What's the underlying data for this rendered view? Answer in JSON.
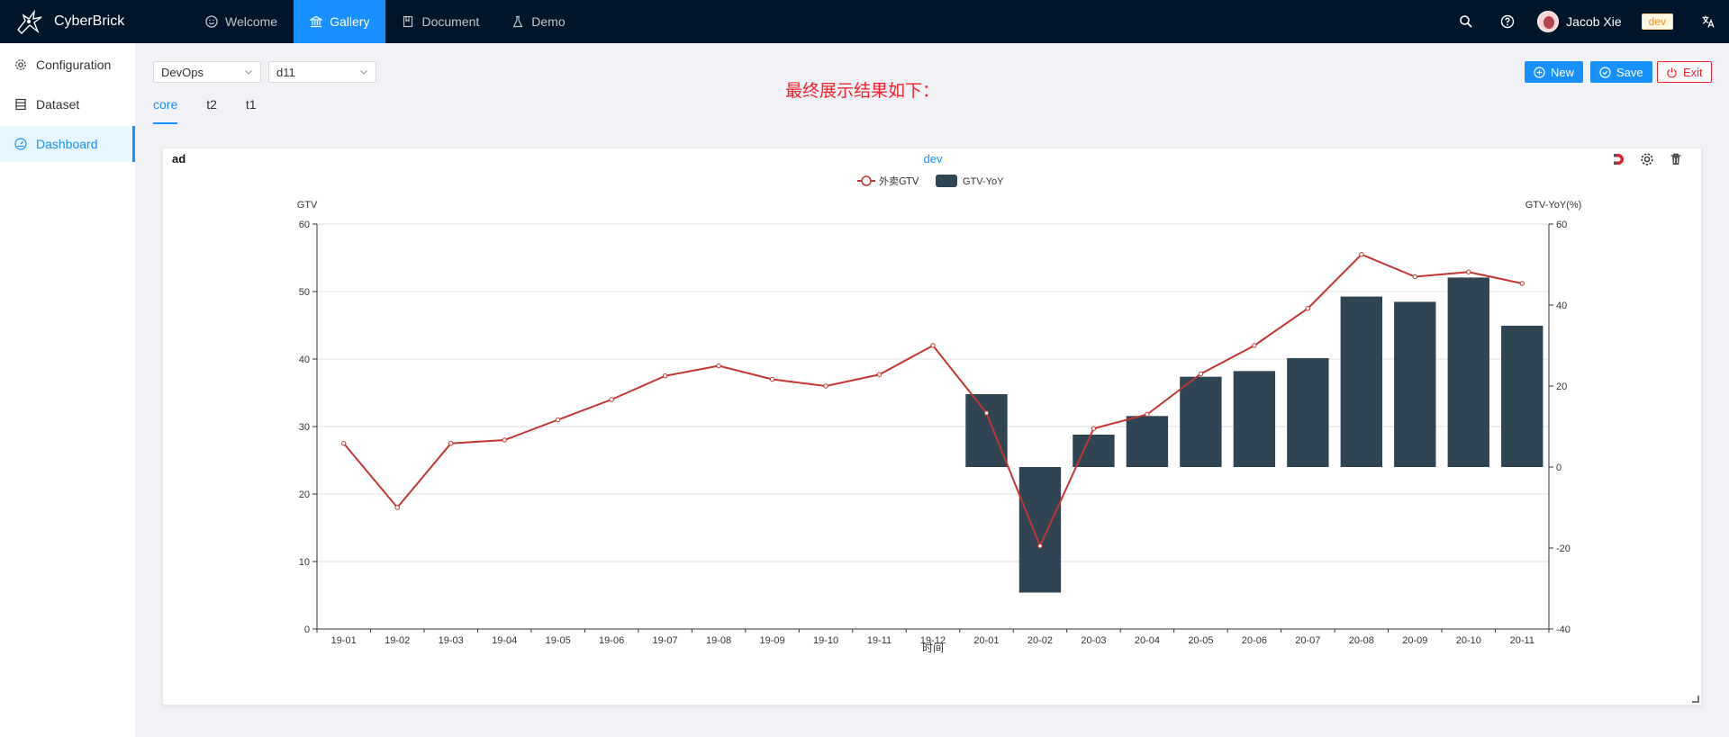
{
  "app": {
    "name": "CyberBrick"
  },
  "nav": {
    "items": [
      {
        "label": "Welcome",
        "icon": "smile-icon"
      },
      {
        "label": "Gallery",
        "icon": "bank-icon"
      },
      {
        "label": "Document",
        "icon": "book-icon"
      },
      {
        "label": "Demo",
        "icon": "experiment-icon"
      }
    ],
    "active": "Gallery"
  },
  "header_right": {
    "user_name": "Jacob Xie",
    "env_tag": "dev"
  },
  "sidebar": {
    "items": [
      {
        "label": "Configuration",
        "icon": "setting-icon"
      },
      {
        "label": "Dataset",
        "icon": "database-icon"
      },
      {
        "label": "Dashboard",
        "icon": "dashboard-icon"
      }
    ],
    "active": "Dashboard"
  },
  "toolbar": {
    "select1": "DevOps",
    "select2": "d11",
    "tabs": [
      "core",
      "t2",
      "t1"
    ],
    "active_tab": "core",
    "note": "最终展示结果如下：",
    "new_label": "New",
    "save_label": "Save",
    "exit_label": "Exit"
  },
  "panel": {
    "title": "ad"
  },
  "colors": {
    "accent": "#1890ff",
    "header_bg": "#001529",
    "bar": "#2f4554",
    "line": "#c23531",
    "danger": "#f5222d"
  },
  "chart_data": {
    "type": "bar",
    "title": "dev",
    "xlabel": "时间",
    "ylabel_left": "GTV",
    "ylabel_right": "GTV-YoY(%)",
    "legend_position": "top-center",
    "grid": true,
    "categories": [
      "19-01",
      "19-02",
      "19-03",
      "19-04",
      "19-05",
      "19-06",
      "19-07",
      "19-08",
      "19-09",
      "19-10",
      "19-11",
      "19-12",
      "20-01",
      "20-02",
      "20-03",
      "20-04",
      "20-05",
      "20-06",
      "20-07",
      "20-08",
      "20-09",
      "20-10",
      "20-11"
    ],
    "ylim_left": [
      0,
      60
    ],
    "yticks_left": [
      0,
      10,
      20,
      30,
      40,
      50,
      60
    ],
    "ylim_right": [
      -40,
      60
    ],
    "yticks_right": [
      -40,
      -20,
      0,
      20,
      40,
      60
    ],
    "series": [
      {
        "name": "外卖GTV",
        "type": "line",
        "axis": "left",
        "values": [
          27.5,
          18,
          27.5,
          28,
          31,
          34,
          37.5,
          39,
          37,
          36,
          37.7,
          42,
          32,
          12.3,
          29.7,
          31.8,
          37.8,
          42,
          47.5,
          55.5,
          52.2,
          52.9,
          51.2
        ]
      },
      {
        "name": "GTV-YoY",
        "type": "bar",
        "axis": "right",
        "values": [
          null,
          null,
          null,
          null,
          null,
          null,
          null,
          null,
          null,
          null,
          null,
          null,
          18,
          -31,
          8,
          12.6,
          22.3,
          23.7,
          26.9,
          42.1,
          40.8,
          46.8,
          34.9
        ]
      }
    ]
  }
}
